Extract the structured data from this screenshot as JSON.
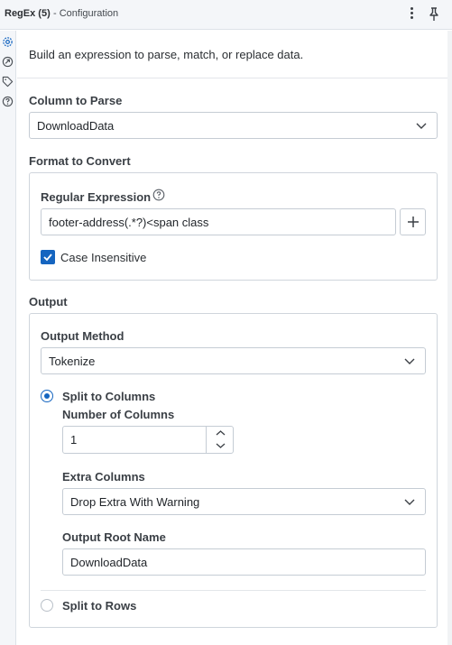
{
  "header": {
    "tool_name": "RegEx (5)",
    "subtitle": "- Configuration",
    "icons": [
      "more-vertical-icon",
      "pin-icon"
    ]
  },
  "sidebar": {
    "icons": [
      "gear-icon",
      "arrow-circle-icon",
      "tag-icon",
      "help-circle-icon"
    ]
  },
  "description": "Build an expression to parse, match, or replace data.",
  "column_to_parse": {
    "label": "Column to Parse",
    "value": "DownloadData"
  },
  "format": {
    "label": "Format to Convert",
    "regex_label": "Regular Expression",
    "regex_value": "footer-address(.*?)<span class",
    "case_insensitive_label": "Case Insensitive",
    "case_insensitive_checked": true
  },
  "output": {
    "label": "Output",
    "method_label": "Output Method",
    "method_value": "Tokenize",
    "split_columns_label": "Split to Columns",
    "num_columns_label": "Number of Columns",
    "num_columns_value": "1",
    "extra_columns_label": "Extra Columns",
    "extra_columns_value": "Drop Extra With Warning",
    "root_name_label": "Output Root Name",
    "root_name_value": "DownloadData",
    "split_rows_label": "Split to Rows",
    "selected": "Split to Columns"
  },
  "colors": {
    "accent": "#1565c0",
    "border": "#c5ccd4",
    "panel_bg": "#f4f6f9"
  }
}
